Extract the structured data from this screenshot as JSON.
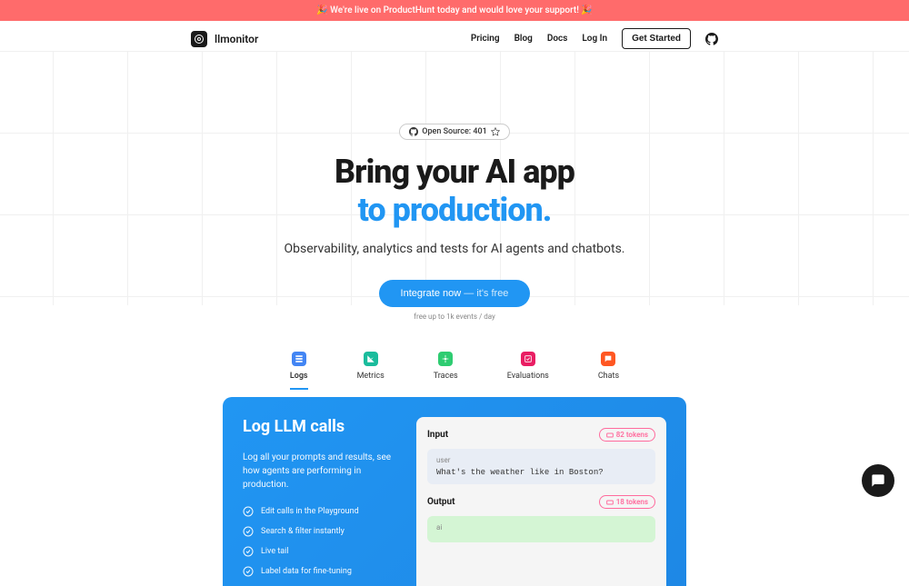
{
  "banner": "🎉  We're live on ProductHunt today and would love your support!  🎉",
  "brand": "llmonitor",
  "nav": {
    "pricing": "Pricing",
    "blog": "Blog",
    "docs": "Docs",
    "login": "Log In",
    "get_started": "Get Started"
  },
  "badge": {
    "label": "Open Source: 401"
  },
  "hero": {
    "title_dark": "Bring your AI app",
    "title_blue": "to production.",
    "subtitle": "Observability, analytics and tests for AI agents and chatbots.",
    "cta_main": "Integrate now",
    "cta_sub": " — it's free",
    "cta_note": "free up to 1k events / day"
  },
  "tabs": [
    {
      "label": "Logs",
      "color": "#4285f4",
      "active": true
    },
    {
      "label": "Metrics",
      "color": "#1abc9c",
      "active": false
    },
    {
      "label": "Traces",
      "color": "#2ecc71",
      "active": false
    },
    {
      "label": "Evaluations",
      "color": "#e91e63",
      "active": false
    },
    {
      "label": "Chats",
      "color": "#ff5722",
      "active": false
    }
  ],
  "feature": {
    "title": "Log LLM calls",
    "desc": "Log all your prompts and results, see how agents are performing in production.",
    "items": [
      "Edit calls in the Playground",
      "Search & filter instantly",
      "Live tail",
      "Label data for fine-tuning"
    ],
    "input": {
      "label": "Input",
      "tokens": "82 tokens",
      "role": "user",
      "text": "What's the weather like in Boston?"
    },
    "output": {
      "label": "Output",
      "tokens": "18 tokens",
      "role": "ai"
    }
  }
}
